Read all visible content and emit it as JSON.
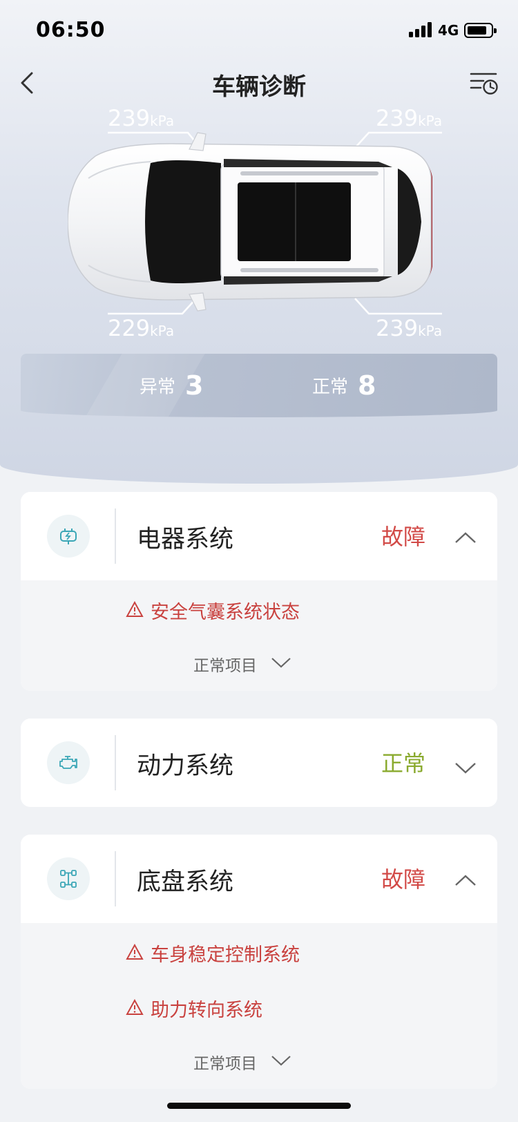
{
  "status_bar": {
    "time": "06:50",
    "network": "4G"
  },
  "header": {
    "title": "车辆诊断"
  },
  "tyres": {
    "front_left": {
      "value": "239",
      "unit": "kPa"
    },
    "front_right": {
      "value": "239",
      "unit": "kPa"
    },
    "rear_left": {
      "value": "229",
      "unit": "kPa"
    },
    "rear_right": {
      "value": "239",
      "unit": "kPa"
    }
  },
  "summary": {
    "abnormal_label": "异常",
    "abnormal_count": "3",
    "normal_label": "正常",
    "normal_count": "8"
  },
  "systems": [
    {
      "title": "电器系统",
      "status": "故障",
      "icon": "battery-plug-icon",
      "faults": [
        "安全气囊系统状态"
      ],
      "normal_items_label": "正常项目"
    },
    {
      "title": "动力系统",
      "status": "正常",
      "icon": "engine-icon",
      "faults": [],
      "normal_items_label": ""
    },
    {
      "title": "底盘系统",
      "status": "故障",
      "icon": "chassis-icon",
      "faults": [
        "车身稳定控制系统",
        "助力转向系统"
      ],
      "normal_items_label": "正常项目"
    }
  ],
  "colors": {
    "fault": "#d24a47",
    "ok": "#8aaa2e",
    "icon_tint": "#3aa6b6"
  }
}
